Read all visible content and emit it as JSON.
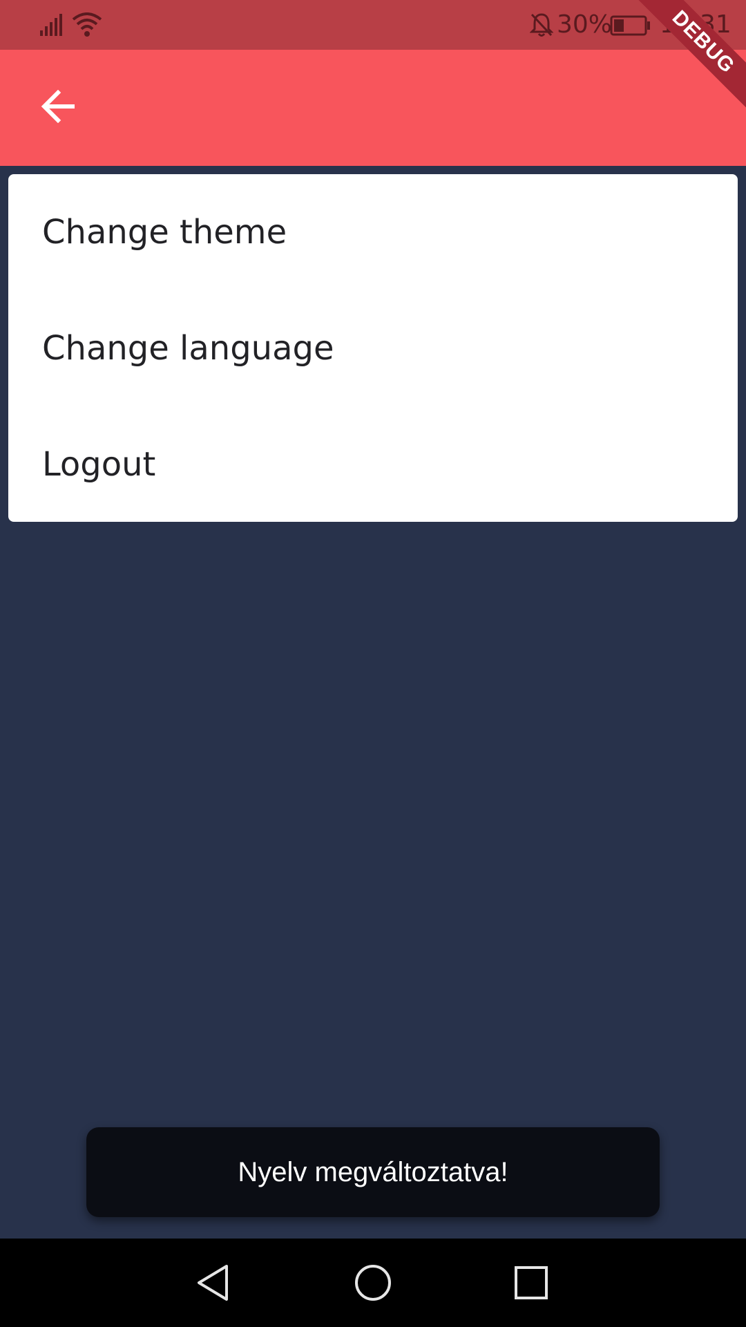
{
  "status_bar": {
    "battery_percent": "30%",
    "time": "18:31",
    "icons": [
      "signal-icon",
      "wifi-icon",
      "bell-off-icon",
      "battery-icon"
    ]
  },
  "app_bar": {
    "back_icon": "arrow-left-icon",
    "color": "#f8555c"
  },
  "debug_banner": "DEBUG",
  "menu": {
    "items": [
      {
        "label": "Change theme"
      },
      {
        "label": "Change language"
      },
      {
        "label": "Logout"
      }
    ]
  },
  "snackbar": {
    "message": "Nyelv megváltoztatva!"
  },
  "nav_bar": {
    "icons": [
      "back-triangle-icon",
      "home-circle-icon",
      "recents-square-icon"
    ]
  },
  "colors": {
    "background": "#28324b",
    "status_bar": "#b83f46",
    "snackbar": "#0b0d14"
  }
}
